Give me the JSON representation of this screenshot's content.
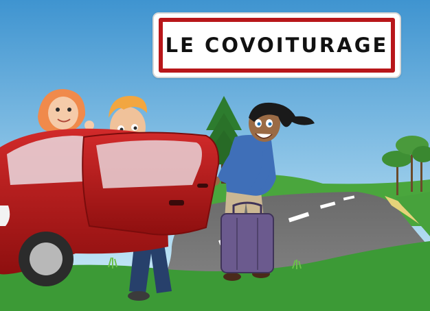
{
  "sign": {
    "title": "LE COVOITURAGE"
  },
  "colors": {
    "sky_top": "#3f94d0",
    "sky_bottom": "#cfeefb",
    "grass": "#3c9a36",
    "road": "#6f6f6f",
    "car": "#b71c1c",
    "sign_border": "#b8161a"
  },
  "illustration": {
    "people": [
      "woman-in-car",
      "man-at-door",
      "woman-with-suitcase"
    ],
    "objects": [
      "red-car",
      "purple-suitcase",
      "road",
      "pine-tree",
      "trees"
    ]
  }
}
